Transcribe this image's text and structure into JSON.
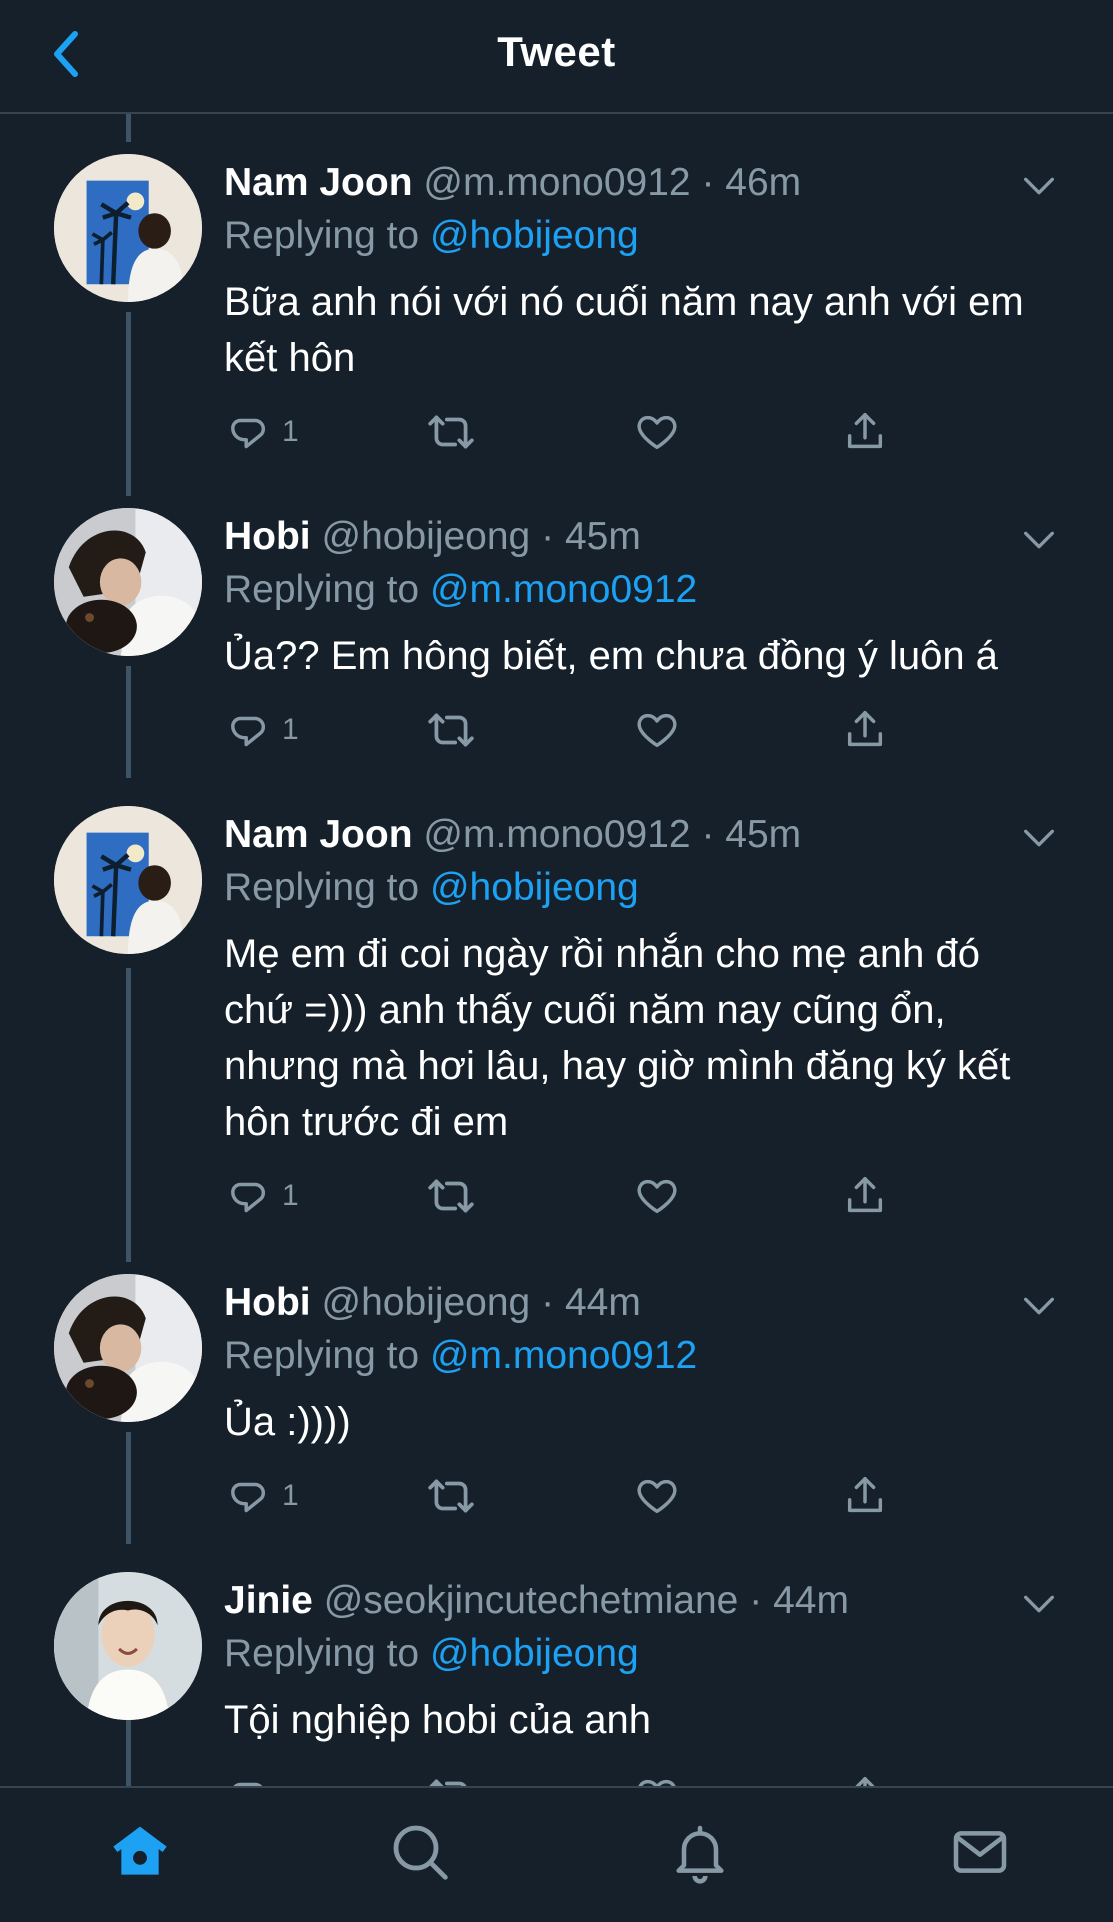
{
  "header": {
    "title": "Tweet",
    "back_icon": "chevron-left-icon"
  },
  "colors": {
    "background": "#15202b",
    "accent": "#1da1f2",
    "muted": "#8899a6",
    "thread": "#3d5466"
  },
  "tweets": [
    {
      "name": "Nam Joon",
      "handle": "@m.mono0912",
      "separator": "·",
      "time": "46m",
      "replying_label": "Replying to",
      "replying_to": "@hobijeong",
      "text": "Bữa anh nói với nó cuối năm nay anh với em kết hôn",
      "reply_count": "1",
      "avatar": "palm-poster-avatar"
    },
    {
      "name": "Hobi",
      "handle": "@hobijeong",
      "separator": "·",
      "time": "45m",
      "replying_label": "Replying to",
      "replying_to": "@m.mono0912",
      "text": "Ủa?? Em hông biết, em chưa đồng ý luôn á",
      "reply_count": "1",
      "avatar": "dog-hug-avatar"
    },
    {
      "name": "Nam Joon",
      "handle": "@m.mono0912",
      "separator": "·",
      "time": "45m",
      "replying_label": "Replying to",
      "replying_to": "@hobijeong",
      "text": "Mẹ em đi coi ngày rồi nhắn cho mẹ anh đó chứ =))) anh thấy cuối năm nay cũng ổn, nhưng mà hơi lâu, hay giờ mình đăng ký kết hôn trước đi em",
      "reply_count": "1",
      "avatar": "palm-poster-avatar"
    },
    {
      "name": "Hobi",
      "handle": "@hobijeong",
      "separator": "·",
      "time": "44m",
      "replying_label": "Replying to",
      "replying_to": "@m.mono0912",
      "text": "Ủa :))))",
      "reply_count": "1",
      "avatar": "dog-hug-avatar"
    },
    {
      "name": "Jinie",
      "handle": "@seokjincutechetmiane",
      "separator": "·",
      "time": "44m",
      "replying_label": "Replying to",
      "replying_to": "@hobijeong",
      "text": "Tội nghiệp hobi của anh",
      "reply_count": "",
      "avatar": "smiling-man-avatar"
    }
  ],
  "tabbar": {
    "items": [
      {
        "icon": "home-icon",
        "active": true
      },
      {
        "icon": "search-icon",
        "active": false
      },
      {
        "icon": "notifications-bell-icon",
        "active": false
      },
      {
        "icon": "messages-envelope-icon",
        "active": false
      }
    ]
  }
}
